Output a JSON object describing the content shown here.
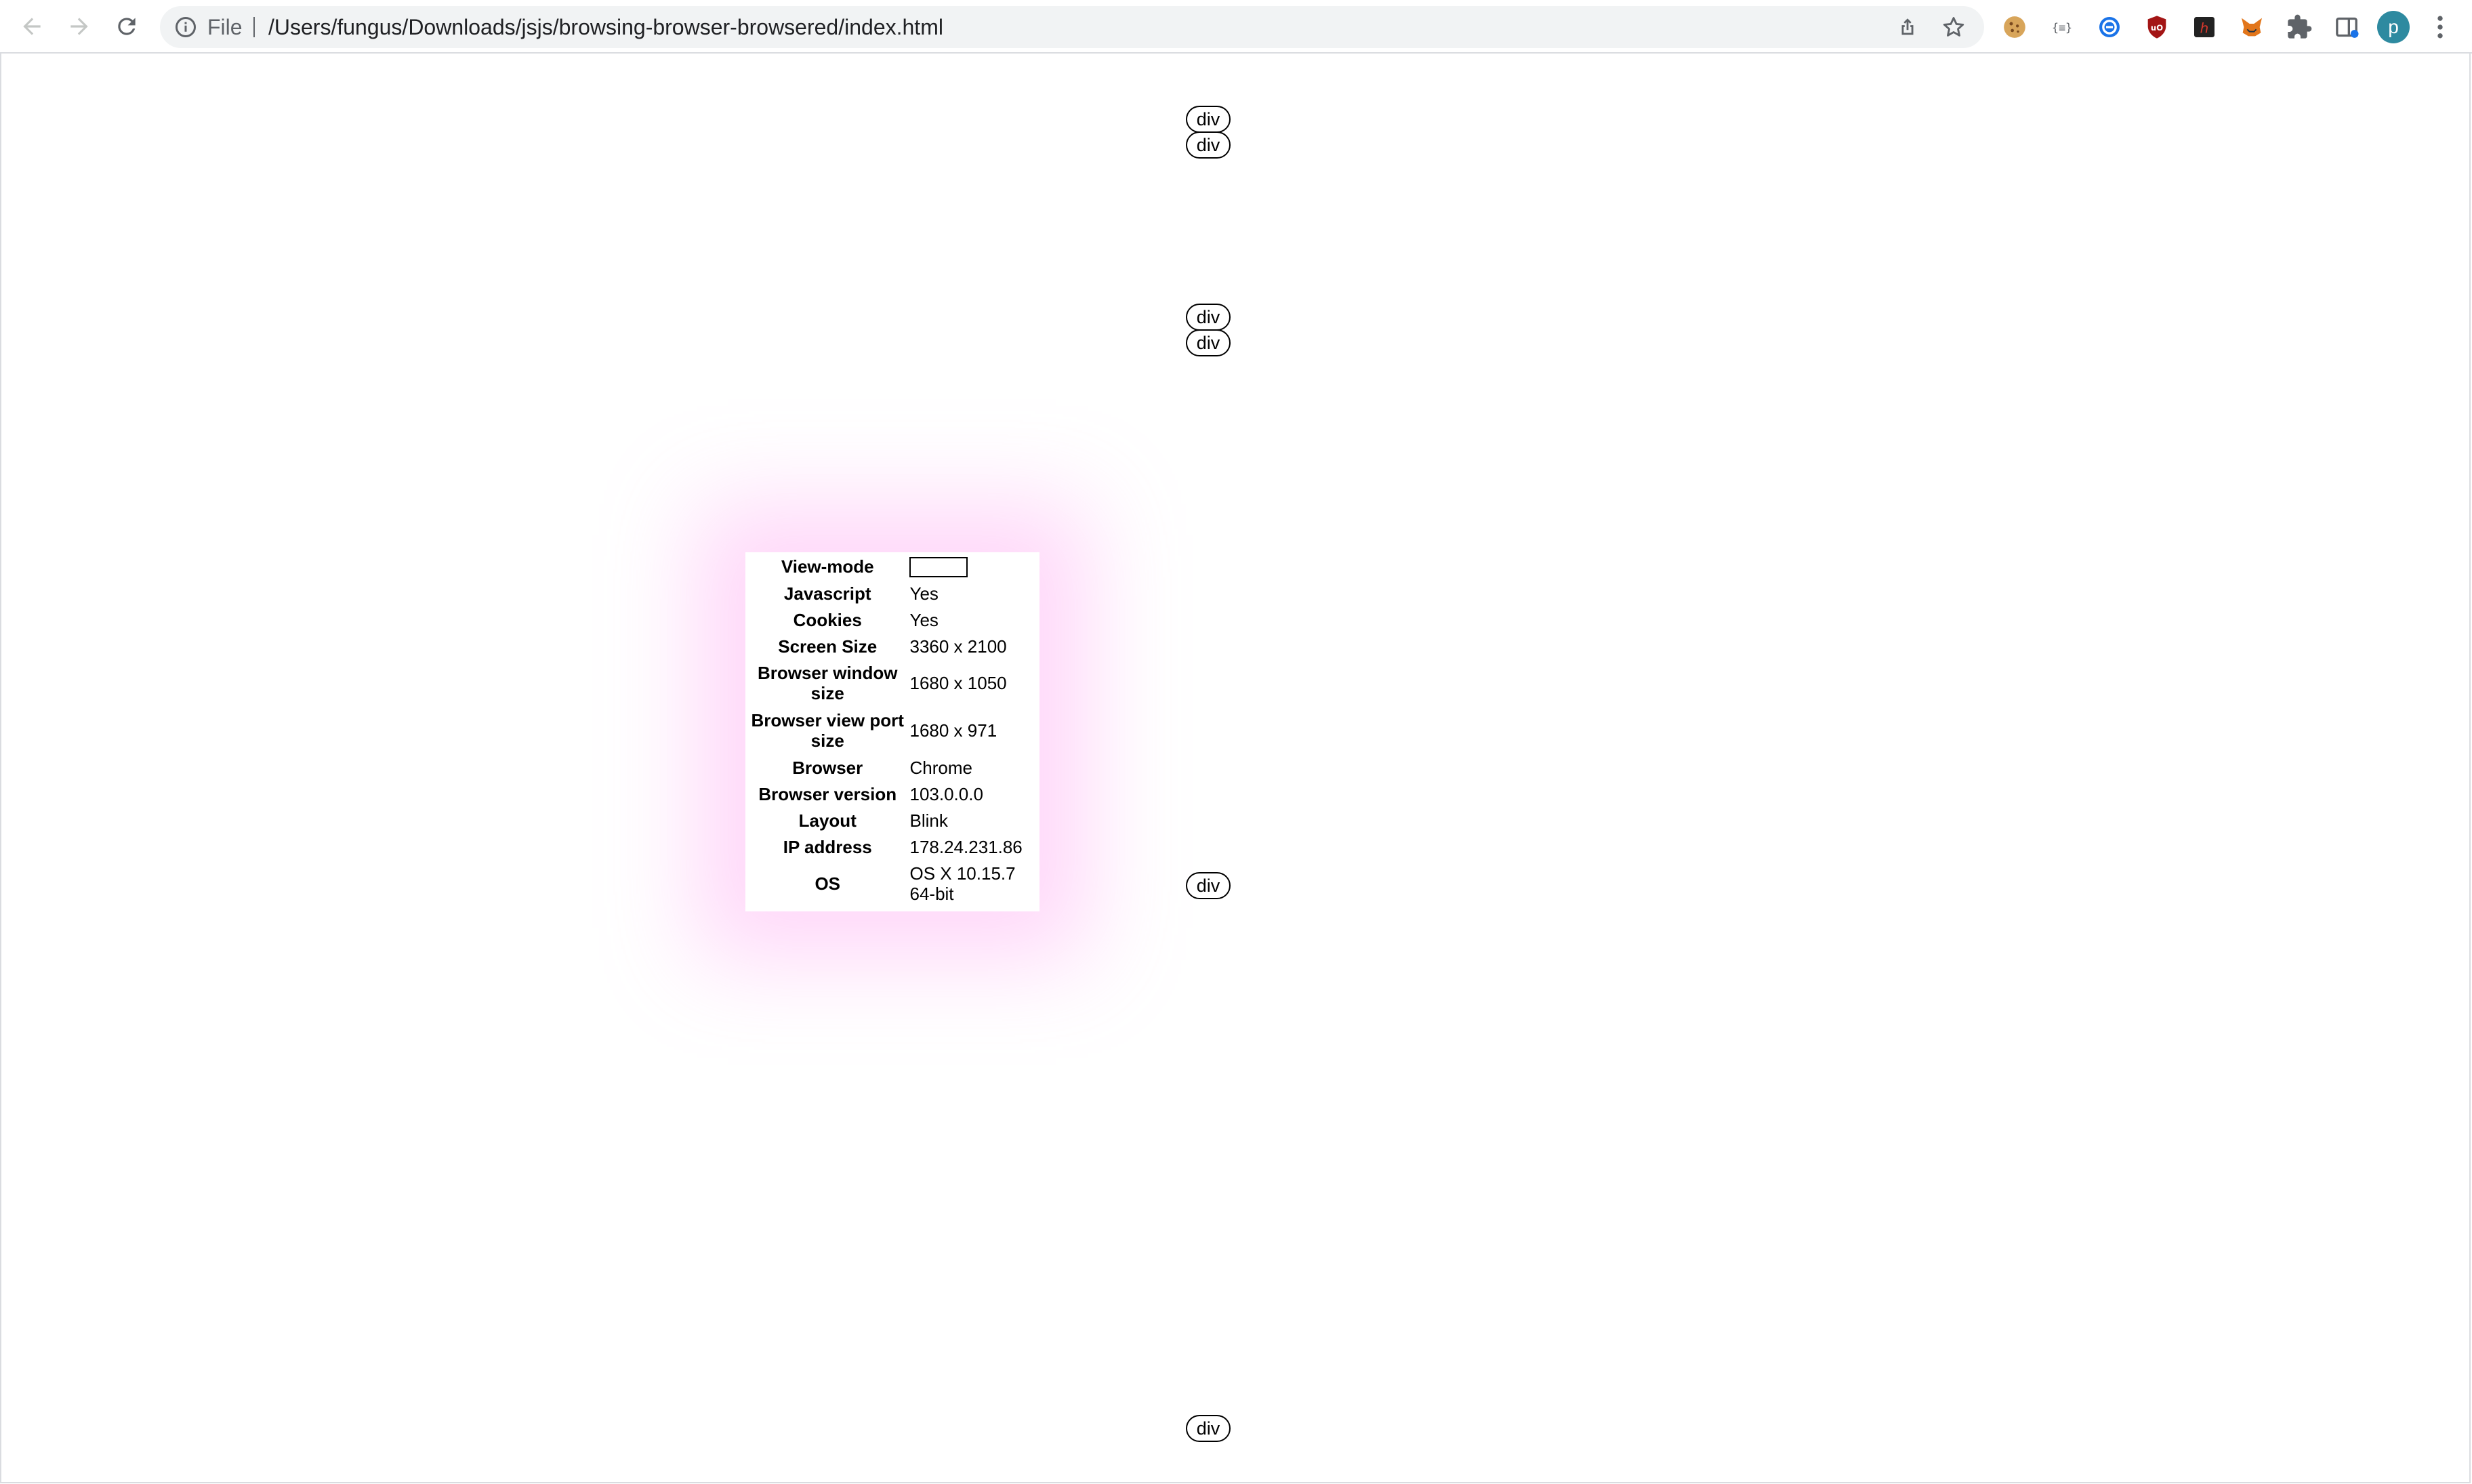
{
  "browser": {
    "omnibox": {
      "scheme_label": "File",
      "url": "/Users/fungus/Downloads/jsjs/browsing-browser-browsered/index.html"
    },
    "profile_initial": "p",
    "extension_icons": [
      "cookie-icon",
      "braces-icon",
      "globe-icon",
      "shield-icon",
      "h-icon",
      "fox-icon",
      "puzzle-icon",
      "side-panel-icon"
    ]
  },
  "page": {
    "div_labels": [
      "div",
      "div",
      "div",
      "div",
      "div",
      "div"
    ],
    "info_rows": [
      {
        "label": "View-mode",
        "value": ""
      },
      {
        "label": "Javascript",
        "value": "Yes"
      },
      {
        "label": "Cookies",
        "value": "Yes"
      },
      {
        "label": "Screen Size",
        "value": "3360 x 2100"
      },
      {
        "label": "Browser window size",
        "value": "1680 x 1050"
      },
      {
        "label": "Browser view port size",
        "value": "1680 x 971"
      },
      {
        "label": "Browser",
        "value": "Chrome"
      },
      {
        "label": "Browser version",
        "value": "103.0.0.0"
      },
      {
        "label": "Layout",
        "value": "Blink"
      },
      {
        "label": "IP address",
        "value": "178.24.231.86"
      },
      {
        "label": "OS",
        "value": "OS X 10.15.7 64-bit"
      }
    ]
  }
}
